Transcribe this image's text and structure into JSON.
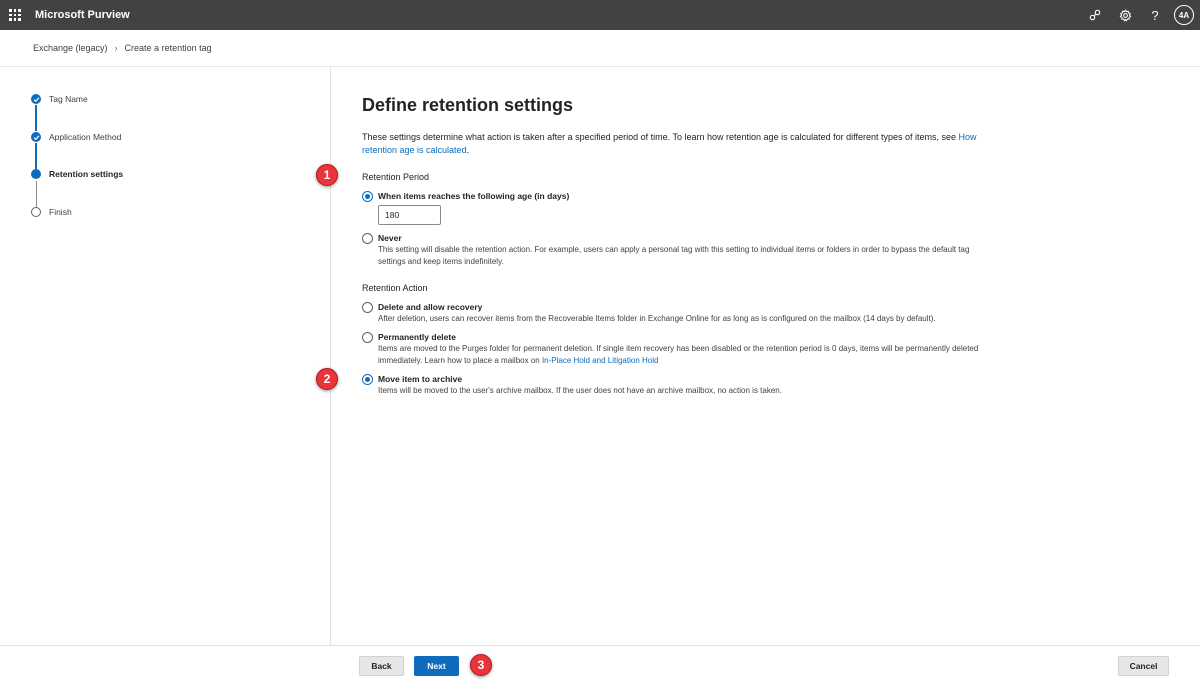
{
  "topbar": {
    "app_title": "Microsoft Purview",
    "avatar_initials": "4A",
    "help_glyph": "?",
    "icons": [
      "waffle-icon",
      "connect-icon",
      "gear-icon",
      "help-icon"
    ]
  },
  "breadcrumb": {
    "items": [
      "Exchange (legacy)",
      "Create a retention tag"
    ],
    "separator": "›"
  },
  "wizard": {
    "steps": [
      {
        "label": "Tag Name",
        "state": "done"
      },
      {
        "label": "Application Method",
        "state": "done"
      },
      {
        "label": "Retention settings",
        "state": "current"
      },
      {
        "label": "Finish",
        "state": "todo"
      }
    ]
  },
  "main": {
    "title": "Define retention settings",
    "description": "These settings determine what action is taken after a specified period of time. To learn how retention age is calculated for different types of items, see ",
    "description_link": "How retention age is calculated",
    "description_end": ".",
    "retention_period": {
      "label": "Retention Period",
      "options": [
        {
          "label": "When items reaches the following age (in days)",
          "checked": true
        },
        {
          "label": "Never",
          "desc": "This setting will disable the retention action. For example, users can apply a personal tag with this setting to individual items or folders in order to bypass the default tag settings and keep items indefinitely.",
          "checked": false
        }
      ],
      "days_value": "180"
    },
    "retention_action": {
      "label": "Retention Action",
      "options": [
        {
          "label": "Delete and allow recovery",
          "desc": "After deletion, users can recover items from the Recoverable Items folder in Exchange Online for as long as is configured on the mailbox (14 days by default).",
          "checked": false
        },
        {
          "label": "Permanently delete",
          "desc": "Items are moved to the Purges folder for permanent deletion. If single item recovery has been disabled or the retention period is 0 days, items will be permanently deleted immediately. Learn how to place a mailbox on ",
          "desc_link": "In-Place Hold and Litigation Hold",
          "checked": false
        },
        {
          "label": "Move item to archive",
          "desc": "Items will be moved to the user's archive mailbox. If the user does not have an archive mailbox, no action is taken.",
          "checked": true
        }
      ]
    }
  },
  "markers": [
    "1",
    "2",
    "3"
  ],
  "footer": {
    "back_label": "Back",
    "next_label": "Next",
    "cancel_label": "Cancel"
  },
  "colors": {
    "accent": "#0f6cbd",
    "topbar": "#424242",
    "marker": "#e8343a"
  }
}
